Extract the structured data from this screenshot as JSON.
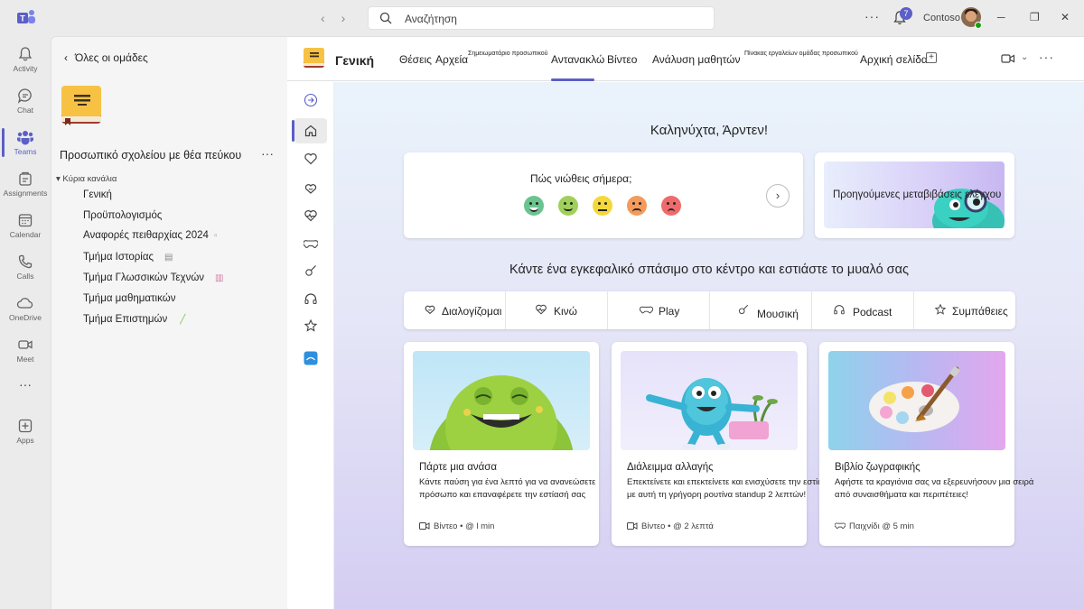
{
  "topbar": {
    "search_label": "Αναζήτηση",
    "notification_count": "7",
    "org_name": "Contoso"
  },
  "rail": [
    {
      "label": "Activity"
    },
    {
      "label": "Chat"
    },
    {
      "label": "Teams"
    },
    {
      "label": "Assignments"
    },
    {
      "label": "Calendar"
    },
    {
      "label": "Calls"
    },
    {
      "label": "OneDrive"
    },
    {
      "label": "Meet"
    },
    {
      "label": "Apps"
    }
  ],
  "teampanel": {
    "back_label": "Όλες οι ομάδες",
    "team_name": "Προσωπικό σχολείου με θέα πεύκου",
    "group_header": "Κύρια κανάλια",
    "channels": [
      {
        "label": "Γενική"
      },
      {
        "label": "Προϋπολογισμός"
      },
      {
        "label": "Αναφορές πειθαρχίας 2024"
      },
      {
        "label": "Τμήμα Ιστορίας"
      },
      {
        "label": "Τμήμα Γλωσσικών Τεχνών"
      },
      {
        "label": "Τμήμα μαθηματικών"
      },
      {
        "label": "Τμήμα Επιστημών"
      }
    ]
  },
  "channel_header": {
    "title": "Γενική",
    "tabs": [
      {
        "label": "Θέσεις"
      },
      {
        "label": "Αρχεία"
      },
      {
        "label": "Σημειωματάριο προσωπικού"
      },
      {
        "label": "Αντανακλώ"
      },
      {
        "label": "Βίντεο"
      },
      {
        "label": "Ανάλυση μαθητών"
      },
      {
        "label": "Πίνακας εργαλείων ομάδας προσωπικού"
      },
      {
        "label": "Αρχική σελίδα"
      }
    ]
  },
  "reflect": {
    "greeting": "Καληνύχτα, Άρντεν!",
    "mood_question": "Πώς νιώθεις σήμερα;",
    "previous_label": "Προηγούμενες μεταβιβάσεις ελέγχου",
    "section_title": "Κάντε ένα εγκεφαλικό σπάσιμο στο κέντρο και εστιάστε το μυαλό σας",
    "categories": [
      {
        "label": "Διαλογίζομαι"
      },
      {
        "label": "Κινώ"
      },
      {
        "label": "Play"
      },
      {
        "label": "Μουσική"
      },
      {
        "label": "Podcast"
      },
      {
        "label": "Συμπάθειες"
      }
    ],
    "activities": [
      {
        "title": "Πάρτε μια ανάσα",
        "description": "Κάντε παύση για ένα λεπτό για να ανανεώσετε πρόσωπο και επαναφέρετε την εστίασή σας",
        "meta": "Βίντεο • @ l min"
      },
      {
        "title": "Διάλειμμα αλλαγής",
        "description": "Επεκτείνετε και επεκτείνετε και ενισχύσετε την εστίαση με αυτή τη γρήγορη ρουτίνα standup 2 λεπτών!",
        "meta": "Βίντεο • @ 2 λεπτά"
      },
      {
        "title": "Βιβλίο ζωγραφικής",
        "description": "Αφήστε τα κραγιόνια σας να εξερευνήσουν μια σειρά από συναισθήματα και περιπέτειες!",
        "meta": "Παιχνίδι @    5 min"
      }
    ]
  },
  "colors": {
    "accent": "#5b5fc7",
    "rail_bg": "#ebebeb",
    "panel_bg": "#f5f5f5"
  }
}
